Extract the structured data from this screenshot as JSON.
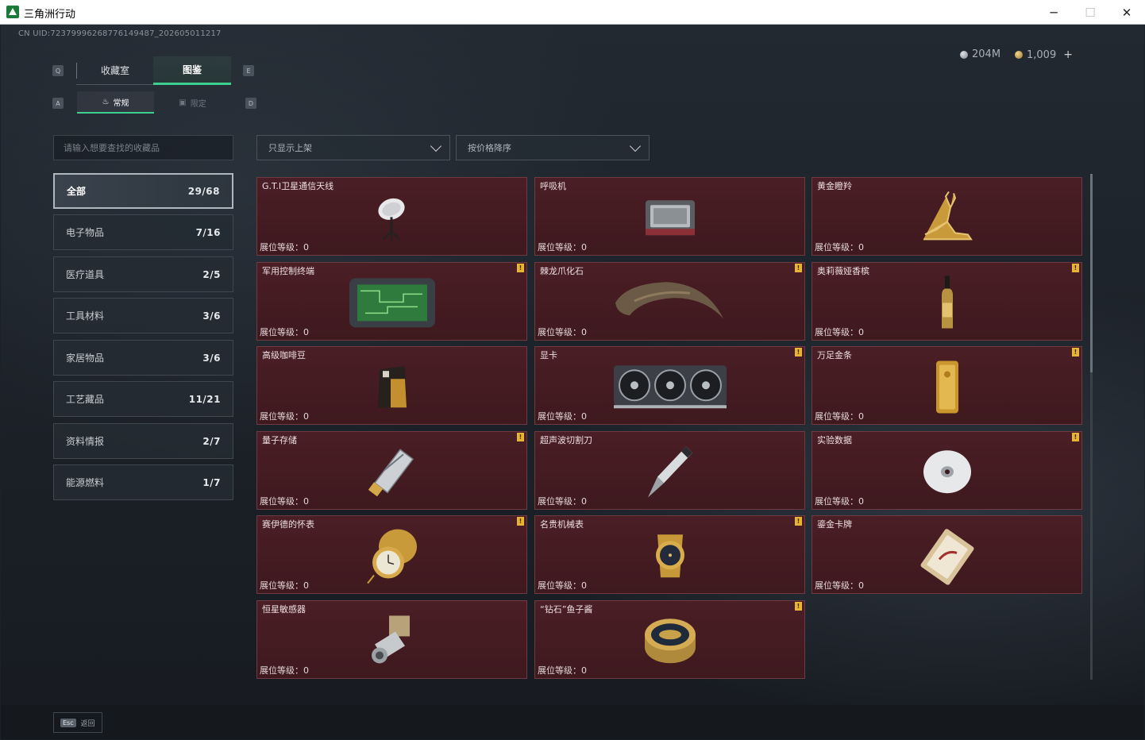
{
  "window": {
    "title": "三角洲行动",
    "minimize": "─",
    "maximize": "☐",
    "close": "✕"
  },
  "uid": "CN UID:7237999626877614948​7_20260501121​7",
  "currency": {
    "silver": "204M",
    "gold": "1,009",
    "plus": "+"
  },
  "keys": {
    "prev_tab": "Q",
    "next_tab": "E",
    "prev_sub": "A",
    "next_sub": "D"
  },
  "tabs": [
    {
      "label": "收藏室"
    },
    {
      "label": "图鉴"
    }
  ],
  "subtabs": [
    {
      "label": "常规",
      "icon": "flame-icon"
    },
    {
      "label": "限定",
      "icon": "card-icon"
    }
  ],
  "search": {
    "placeholder": "请输入想要查找的收藏品"
  },
  "filters": {
    "shelf": "只显示上架",
    "sort": "按价格降序"
  },
  "categories": [
    {
      "label": "全部",
      "count": "29/68"
    },
    {
      "label": "电子物品",
      "count": "7/16"
    },
    {
      "label": "医疗道具",
      "count": "2/5"
    },
    {
      "label": "工具材料",
      "count": "3/6"
    },
    {
      "label": "家居物品",
      "count": "3/6"
    },
    {
      "label": "工艺藏品",
      "count": "11/21"
    },
    {
      "label": "资料情报",
      "count": "2/7"
    },
    {
      "label": "能源燃料",
      "count": "1/7"
    }
  ],
  "items": [
    {
      "name": "G.T.I卫星通信天线",
      "level": "展位等级：0",
      "badge": ""
    },
    {
      "name": "呼吸机",
      "level": "展位等级：0",
      "badge": ""
    },
    {
      "name": "黄金瞪羚",
      "level": "展位等级：0",
      "badge": ""
    },
    {
      "name": "军用控制终端",
      "level": "展位等级：0",
      "badge": "!"
    },
    {
      "name": "棘龙爪化石",
      "level": "展位等级：0",
      "badge": "!"
    },
    {
      "name": "奥莉薇娅香槟",
      "level": "展位等级：0",
      "badge": "!"
    },
    {
      "name": "高级咖啡豆",
      "level": "展位等级：0",
      "badge": ""
    },
    {
      "name": "显卡",
      "level": "展位等级：0",
      "badge": "!"
    },
    {
      "name": "万足金条",
      "level": "展位等级：0",
      "badge": "!"
    },
    {
      "name": "量子存储",
      "level": "展位等级：0",
      "badge": "!"
    },
    {
      "name": "超声波切割刀",
      "level": "展位等级：0",
      "badge": ""
    },
    {
      "name": "实验数据",
      "level": "展位等级：0",
      "badge": "!"
    },
    {
      "name": "赛伊德的怀表",
      "level": "展位等级：0",
      "badge": "!"
    },
    {
      "name": "名贵机械表",
      "level": "展位等级：0",
      "badge": "!"
    },
    {
      "name": "鎏金卡牌",
      "level": "展位等级：0",
      "badge": ""
    },
    {
      "name": "恒星敏感器",
      "level": "展位等级：0",
      "badge": ""
    },
    {
      "name": "“钻石”鱼子酱",
      "level": "展位等级：0",
      "badge": "!"
    }
  ],
  "footer": {
    "key": "Esc",
    "label": "返回"
  }
}
